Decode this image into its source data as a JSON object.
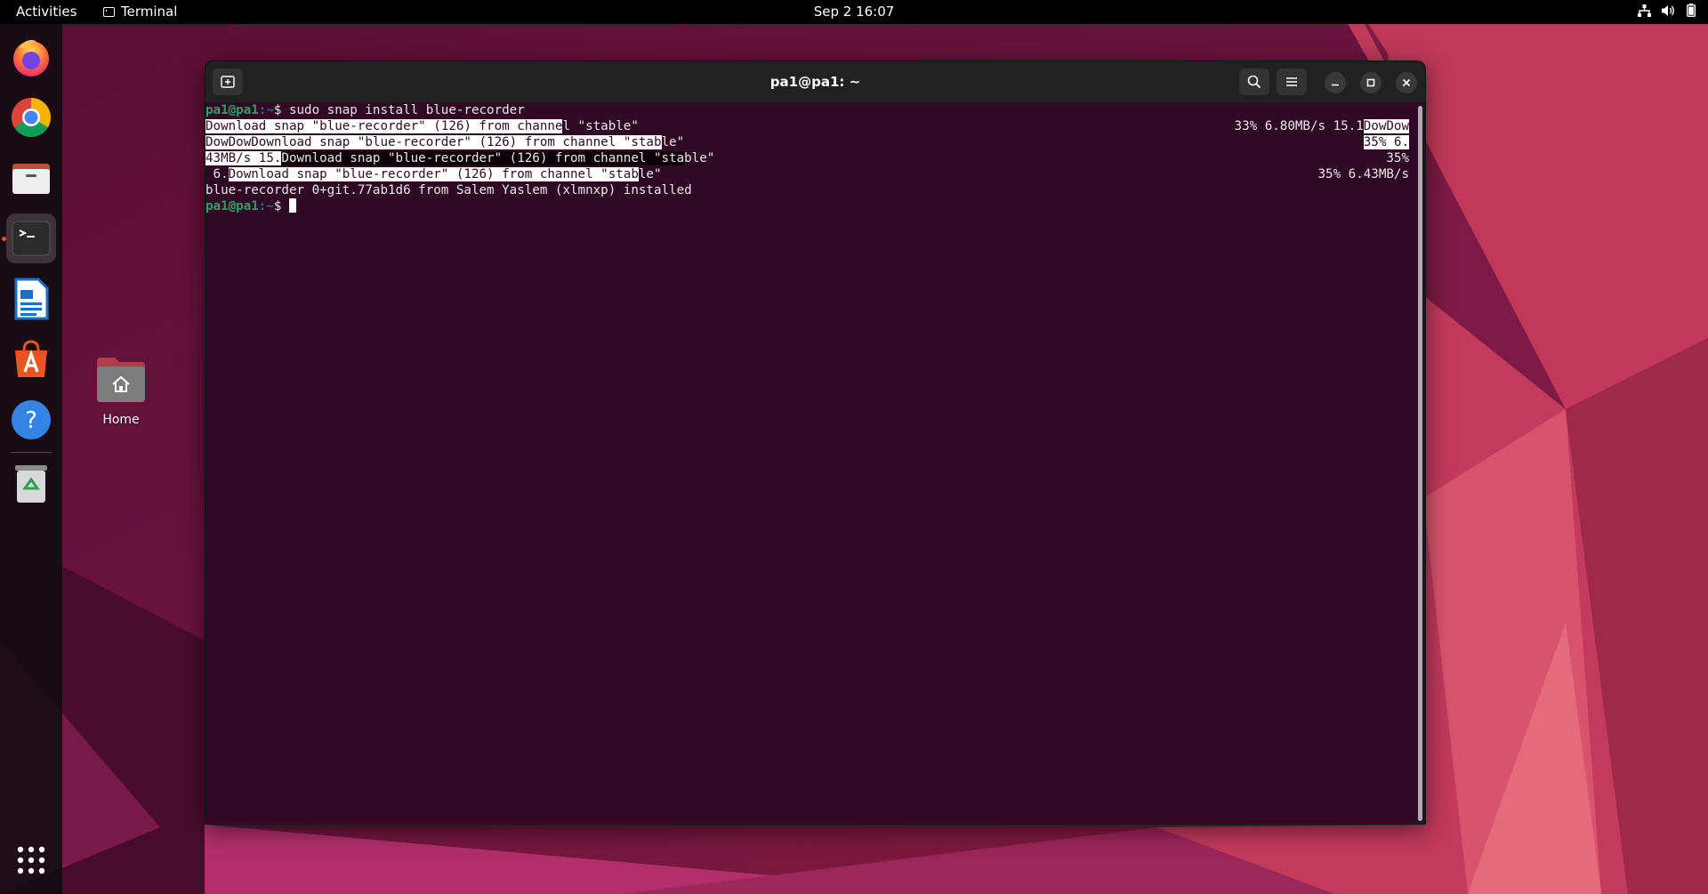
{
  "topbar": {
    "activities": "Activities",
    "app_name": "Terminal",
    "clock": "Sep 2  16:07",
    "tray_icons": [
      "network-icon",
      "volume-icon",
      "battery-icon"
    ]
  },
  "dock": {
    "apps": [
      "Firefox",
      "Google Chrome",
      "Files",
      "Terminal",
      "LibreOffice Writer",
      "Ubuntu Software",
      "Help",
      "Trash",
      "Show Applications"
    ],
    "active_app": "Terminal",
    "accent_color": "#e95420"
  },
  "desktop": {
    "home_label": "Home"
  },
  "terminal": {
    "title": "pa1@pa1: ~",
    "background": "#300a24",
    "prompt_user": "pa1@pa1",
    "prompt_path": ":~",
    "prompt_symbol": "$",
    "command": " sudo snap install blue-recorder",
    "lines": [
      {
        "pre": "Download snap \"blue-recorder\" (126) from channe",
        "hl": "l \"stable\"",
        "post": "",
        "right_pre": "33% 6.80MB/s 15.1",
        "right_hl": "DowDow"
      },
      {
        "pre": "DowDowDownload snap \"blue-recorder\" (126) from channel \"stab",
        "hl": "le\"",
        "post": "",
        "right_pre": "35% 6.",
        "right_hl": ""
      },
      {
        "pre": "43MB/s 15.",
        "hl": "Download snap \"blue-recorder\" (126) from channel \"sta",
        "post": "ble\"",
        "right_pre": "35%",
        "right_hl": ""
      },
      {
        "pre": " 6.",
        "hl": "Download snap \"blue-recorder\" (126) from channel \"stab",
        "post": "le\"",
        "right_pre": "35% 6.43MB/s",
        "right_hl": ""
      }
    ],
    "result": "blue-recorder 0+git.77ab1d6 from Salem Yaslem (xlmnxp) installed"
  }
}
